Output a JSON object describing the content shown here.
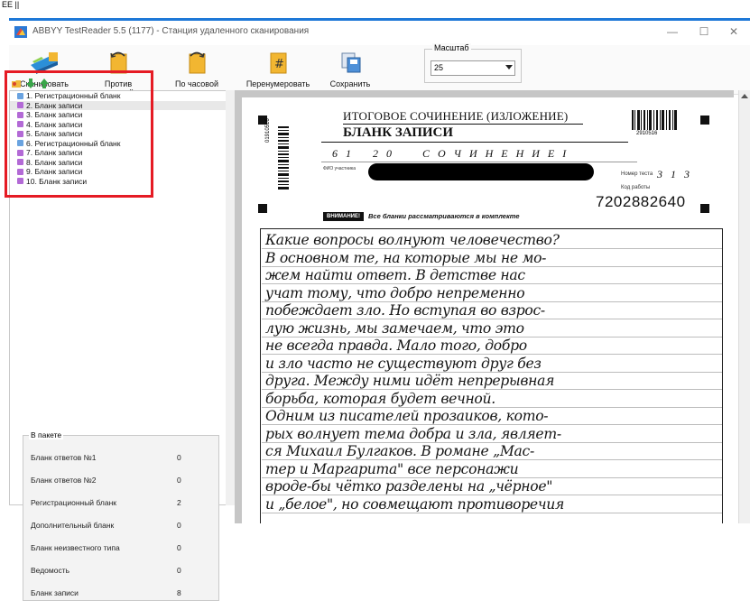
{
  "fragment": "ЕЕ ||",
  "window": {
    "title": "ABBYY TestReader 5.5 (1177) - Станция удаленного сканирования",
    "minimize": "—",
    "maximize": "☐",
    "close": "✕"
  },
  "toolbar": {
    "scan_label": "Сканировать",
    "rotate_ccw_label": "Против часовой",
    "rotate_cw_label": "По часовой",
    "renumber_label": "Перенумеровать",
    "save_label": "Сохранить",
    "scale_label": "Масштаб",
    "scale_value": "25"
  },
  "tree": {
    "items": [
      {
        "label": "1. Регистрационный бланк",
        "color": "#6aa3e0"
      },
      {
        "label": "2. Бланк записи",
        "color": "#b36ad6"
      },
      {
        "label": "3. Бланк записи",
        "color": "#b36ad6"
      },
      {
        "label": "4. Бланк записи",
        "color": "#b36ad6"
      },
      {
        "label": "5. Бланк записи",
        "color": "#b36ad6"
      },
      {
        "label": "6. Регистрационный бланк",
        "color": "#6aa3e0"
      },
      {
        "label": "7. Бланк записи",
        "color": "#b36ad6"
      },
      {
        "label": "8. Бланк записи",
        "color": "#b36ad6"
      },
      {
        "label": "9. Бланк записи",
        "color": "#b36ad6"
      },
      {
        "label": "10. Бланк записи",
        "color": "#b36ad6"
      }
    ]
  },
  "packet": {
    "title": "В пакете",
    "rows": [
      {
        "label": "Бланк ответов №1",
        "value": "0"
      },
      {
        "label": "Бланк ответов №2",
        "value": "0"
      },
      {
        "label": "Регистрационный бланк",
        "value": "2"
      },
      {
        "label": "Дополнительный бланк",
        "value": "0"
      },
      {
        "label": "Бланк неизвестного типа",
        "value": "0"
      },
      {
        "label": "Ведомость",
        "value": "0"
      },
      {
        "label": "Бланк записи",
        "value": "8"
      }
    ]
  },
  "document": {
    "title": "ИТОГОВОЕ СОЧИНЕНИЕ (ИЗЛОЖЕНИЕ)",
    "subtitle": "БЛАНК ЗАПИСИ",
    "barcode_left_text": "01910516",
    "barcode_right_text": "2910516",
    "region_code": "6 1",
    "work_type_code": "2 0",
    "work_type_name": "С О Ч И Н Е Н И Е   I",
    "fio_label": "ФИО участника",
    "sheet_number_label": "Номер теста",
    "sheet_number": "3 1 3",
    "work_code_label": "Код работы",
    "work_code": "7202882640",
    "warning_label": "ВНИМАНИЕ!",
    "warning_text": "Все бланки рассматриваются в комплекте",
    "handwritten_lines": [
      "Какие вопросы волнуют человечество?",
      "В основном те, на которые мы не мо-",
      "жем найти ответ. В детстве нас",
      "учат тому, что добро непременно",
      "побеждает зло. Но вступая во взрос-",
      "лую жизнь, мы замечаем, что это",
      "не всегда правда. Мало того, добро",
      "и зло часто не существуют друг без",
      "друга. Между ними идёт непрерывная",
      "борьба, которая будет вечной.",
      "   Одним из писателей прозаиков, кото-",
      "рых волнует тема добра и зла, являет-",
      "ся Михаил Булгаков. В романе „Мас-",
      "тер и Маргарита\" все персонажи",
      "вроде-бы чётко разделены на „чёрное\"",
      "и „белое\", но совмещают противоречия"
    ]
  }
}
